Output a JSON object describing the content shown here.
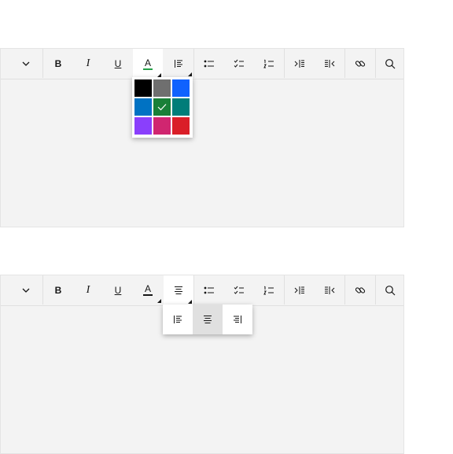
{
  "toolbar": {
    "bold_label": "B",
    "italic_label": "I",
    "underline_label": "U",
    "font_color_label": "A",
    "font_color_underline": "#24a148"
  },
  "editors": [
    {
      "name": "editor-color-picker-open",
      "open_menu": "font-color"
    },
    {
      "name": "editor-alignment-menu-open",
      "open_menu": "alignment"
    }
  ],
  "color_picker": {
    "swatches": [
      {
        "name": "black",
        "color": "#000000"
      },
      {
        "name": "gray",
        "color": "#6f6f6f"
      },
      {
        "name": "blue",
        "color": "#0f62fe"
      },
      {
        "name": "cyan",
        "color": "#0072c3"
      },
      {
        "name": "green",
        "color": "#198038",
        "selected": true
      },
      {
        "name": "teal",
        "color": "#007d79"
      },
      {
        "name": "purple",
        "color": "#8a3ffc"
      },
      {
        "name": "magenta",
        "color": "#d02670"
      },
      {
        "name": "red",
        "color": "#da1e28"
      }
    ]
  },
  "alignment_menu": {
    "options": [
      {
        "name": "align-left",
        "icon": "text-align-left-icon",
        "selected": false
      },
      {
        "name": "align-center",
        "icon": "text-align-center-icon",
        "selected": true
      },
      {
        "name": "align-right",
        "icon": "text-align-right-icon",
        "selected": false
      }
    ]
  },
  "icons": {
    "overflow": "chevron-down-icon",
    "bulleted_list": "list-bulleted-icon",
    "checklist": "list-checked-icon",
    "numbered_list": "list-numbered-icon",
    "indent": "text-indent-more-icon",
    "outdent": "text-indent-less-icon",
    "link": "link-icon",
    "search": "search-icon"
  }
}
